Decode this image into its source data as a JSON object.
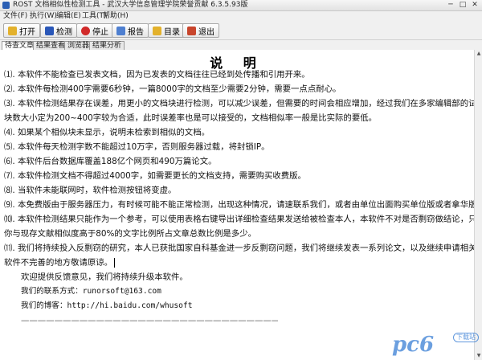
{
  "window": {
    "title": "ROST 文档相似性检测工具 - 武汉大学信息管理学院荣誉贡献 6.3.5.93版",
    "min": "─",
    "max": "□",
    "close": "✕"
  },
  "menu": [
    "文件(F)",
    "执行(W)",
    "编辑(E)",
    "工具(T)",
    "帮助(H)"
  ],
  "toolbar": [
    {
      "label": "打开",
      "icon": "open-folder-icon",
      "color": "#e3b12c"
    },
    {
      "label": "检测",
      "icon": "save-disk-icon",
      "color": "#2a57b8"
    },
    {
      "label": "停止",
      "icon": "stop-icon",
      "color": "#d12a2a"
    },
    {
      "label": "报告",
      "icon": "report-icon",
      "color": "#4e7fd0"
    },
    {
      "label": "目录",
      "icon": "folder-icon",
      "color": "#e3b12c"
    },
    {
      "label": "退出",
      "icon": "exit-icon",
      "color": "#c8452c"
    }
  ],
  "tabs": [
    "待查文章",
    "结果查看",
    "浏览器",
    "结果分析"
  ],
  "document": {
    "title": "说 明",
    "lines": [
      "⑴. 本软件不能检查已发表文档，因为已发表的文档往往已经到处传播和引用开来。",
      "⑵. 本软件每检测400字需要6秒钟，一篇8000字的文档至少需要2分钟，需要一点点耐心。",
      "⑶. 本软件检测结果存在误差，用更小的文档块进行检测，可以减少误差，但需要的时间会相应增加，经过我们在多家编辑部的试用情况，",
      "块数大小定为200~400字较为合适，此时误差率也是可以接受的，文档相似率一般是比实际的要低。",
      "⑷. 如果某个相似块未显示，说明未检索到相似的文档。",
      "⑸. 本软件每天检测字数不能超过10万字，否则服务器过载，将封锁IP。",
      "⑹. 本软件后台数据库覆盖188亿个网页和490万篇论文。",
      "⑺. 本软件检测文档不得超过4000字，如需要更长的文档支持，需要购买收费版。",
      "⑻. 当软件未能联网时，软件检测按钮将变虚。",
      "⑼. 本免费版由于服务器压力，有时候可能不能正常检测，出现这种情况，请速联系我们，或者由单位出面购买单位版或者拿华版。",
      "⑽.  本软件检测结果只能作为一个参考，可以使用表格右键导出详细检查结果发送给被检查本人，本软件不对是否剽窃做结论，只是告诉",
      "你与现存文献相似度高于80%的文字比例所占文章总数比例是多少。",
      "⑾.  我们将持续投入反剽窃的研究，本人已获批国家自科基金进一步反剽窃问题，我们将继续发表一系列论文，以及继续申请相关专利。",
      "软件不完善的地方敬请原谅。",
      "欢迎提供反馈意见，我们将持续升级本软件。",
      "我们的联系方式：runorsoft@163.com",
      "我们的博客：http://hi.baidu.com/whusoft",
      "——————————————————————————————————————————————"
    ]
  },
  "watermark": {
    "text": "pc6",
    "sub": "下载站"
  }
}
